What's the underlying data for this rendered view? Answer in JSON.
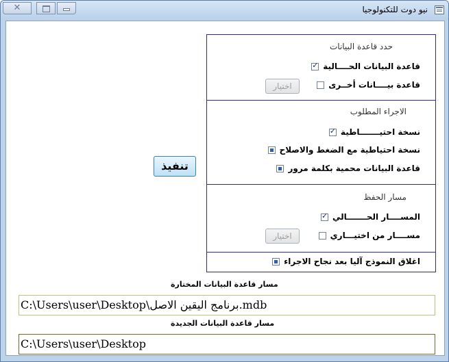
{
  "window": {
    "title": "نيو دوت للتكنولوجيا",
    "close_label": "✕"
  },
  "panel": {
    "db_section": {
      "title": "حدد قاعدة البيانات",
      "options": [
        {
          "label": "قاعدة البيانات الحــــالية",
          "checked": true
        },
        {
          "label": "قاعدة بيــــانات أخــرى",
          "checked": false
        }
      ],
      "choose_button": "اختيار"
    },
    "action_section": {
      "title": "الاجراء المطلوب",
      "options": [
        {
          "label": "نسخة احتيـــــــاطية",
          "checked": true
        },
        {
          "label": "نسخة احتياطية مع الضغط والاصلاح",
          "checked": false
        },
        {
          "label": "قاعدة البيانات محمية بكلمة مرور",
          "checked": false
        }
      ]
    },
    "path_section": {
      "title": "مسار الحفظ",
      "options": [
        {
          "label": "المســــار الحـــــــالي",
          "checked": true
        },
        {
          "label": "مســــار من اختيـــاري",
          "checked": false
        }
      ],
      "choose_button": "اختيار"
    },
    "close_option": {
      "label": "اغلاق النموذج آليا بعد نجاح الاجراء",
      "checked": false
    }
  },
  "execute_button": "تنفيذ",
  "selected_db": {
    "label": "مسار قاعدة البيانات المختارة",
    "value": "C:\\Users\\user\\Desktop\\برنامج اليقين الاصل.mdb"
  },
  "new_db": {
    "label": "مسار قاعدة البيانات الجديدة",
    "value": "C:\\Users\\user\\Desktop"
  }
}
